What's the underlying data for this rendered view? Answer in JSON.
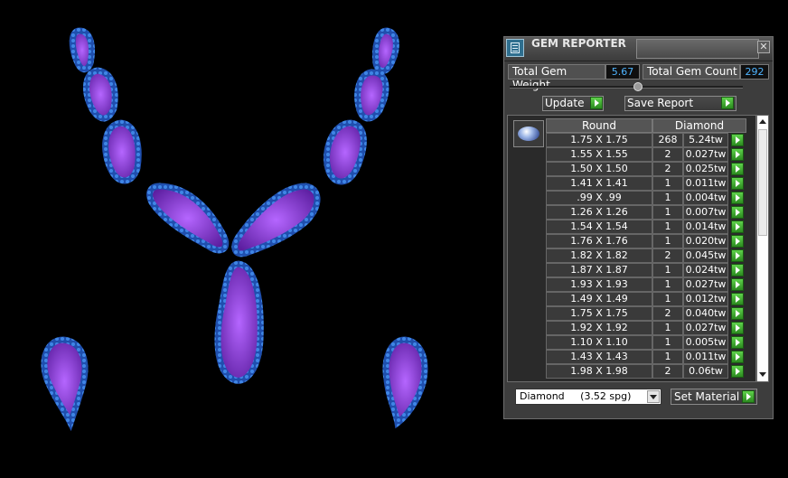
{
  "window": {
    "title": "GEM REPORTER",
    "close_glyph": "✕"
  },
  "stats": {
    "total_weight_label": "Total Gem Weight",
    "total_weight_value": "5.67",
    "total_count_label": "Total Gem Count",
    "total_count_value": "292"
  },
  "buttons": {
    "update": "Update",
    "save_report": "Save Report",
    "set_material": "Set Material"
  },
  "table": {
    "shape_header": "Round",
    "material_header": "Diamond",
    "rows": [
      {
        "size": "1.75 X 1.75",
        "count": "268",
        "weight": "5.24tw"
      },
      {
        "size": "1.55 X 1.55",
        "count": "2",
        "weight": "0.027tw"
      },
      {
        "size": "1.50 X 1.50",
        "count": "2",
        "weight": "0.025tw"
      },
      {
        "size": "1.41 X 1.41",
        "count": "1",
        "weight": "0.011tw"
      },
      {
        "size": ".99 X .99",
        "count": "1",
        "weight": "0.004tw"
      },
      {
        "size": "1.26 X 1.26",
        "count": "1",
        "weight": "0.007tw"
      },
      {
        "size": "1.54 X 1.54",
        "count": "1",
        "weight": "0.014tw"
      },
      {
        "size": "1.76 X 1.76",
        "count": "1",
        "weight": "0.020tw"
      },
      {
        "size": "1.82 X 1.82",
        "count": "2",
        "weight": "0.045tw"
      },
      {
        "size": "1.87 X 1.87",
        "count": "1",
        "weight": "0.024tw"
      },
      {
        "size": "1.93 X 1.93",
        "count": "1",
        "weight": "0.027tw"
      },
      {
        "size": "1.49 X 1.49",
        "count": "1",
        "weight": "0.012tw"
      },
      {
        "size": "1.75 X 1.75",
        "count": "2",
        "weight": "0.040tw"
      },
      {
        "size": "1.92 X 1.92",
        "count": "1",
        "weight": "0.027tw"
      },
      {
        "size": "1.10 X 1.10",
        "count": "1",
        "weight": "0.005tw"
      },
      {
        "size": "1.43 X 1.43",
        "count": "1",
        "weight": "0.011tw"
      },
      {
        "size": "1.98 X 1.98",
        "count": "2",
        "weight": "0.06tw"
      }
    ]
  },
  "material": {
    "selected": "Diamond     (3.52 spg)"
  },
  "colors": {
    "gem_fill": "#8a2bd6",
    "pave": "#2f6fd0",
    "accent_value": "#4fb4ff",
    "button_green": "#3fae2f"
  },
  "icons": [
    "app-icon",
    "close-icon",
    "play-icon",
    "gem-icon",
    "dropdown-arrow-icon",
    "scroll-up-icon",
    "scroll-down-icon"
  ]
}
